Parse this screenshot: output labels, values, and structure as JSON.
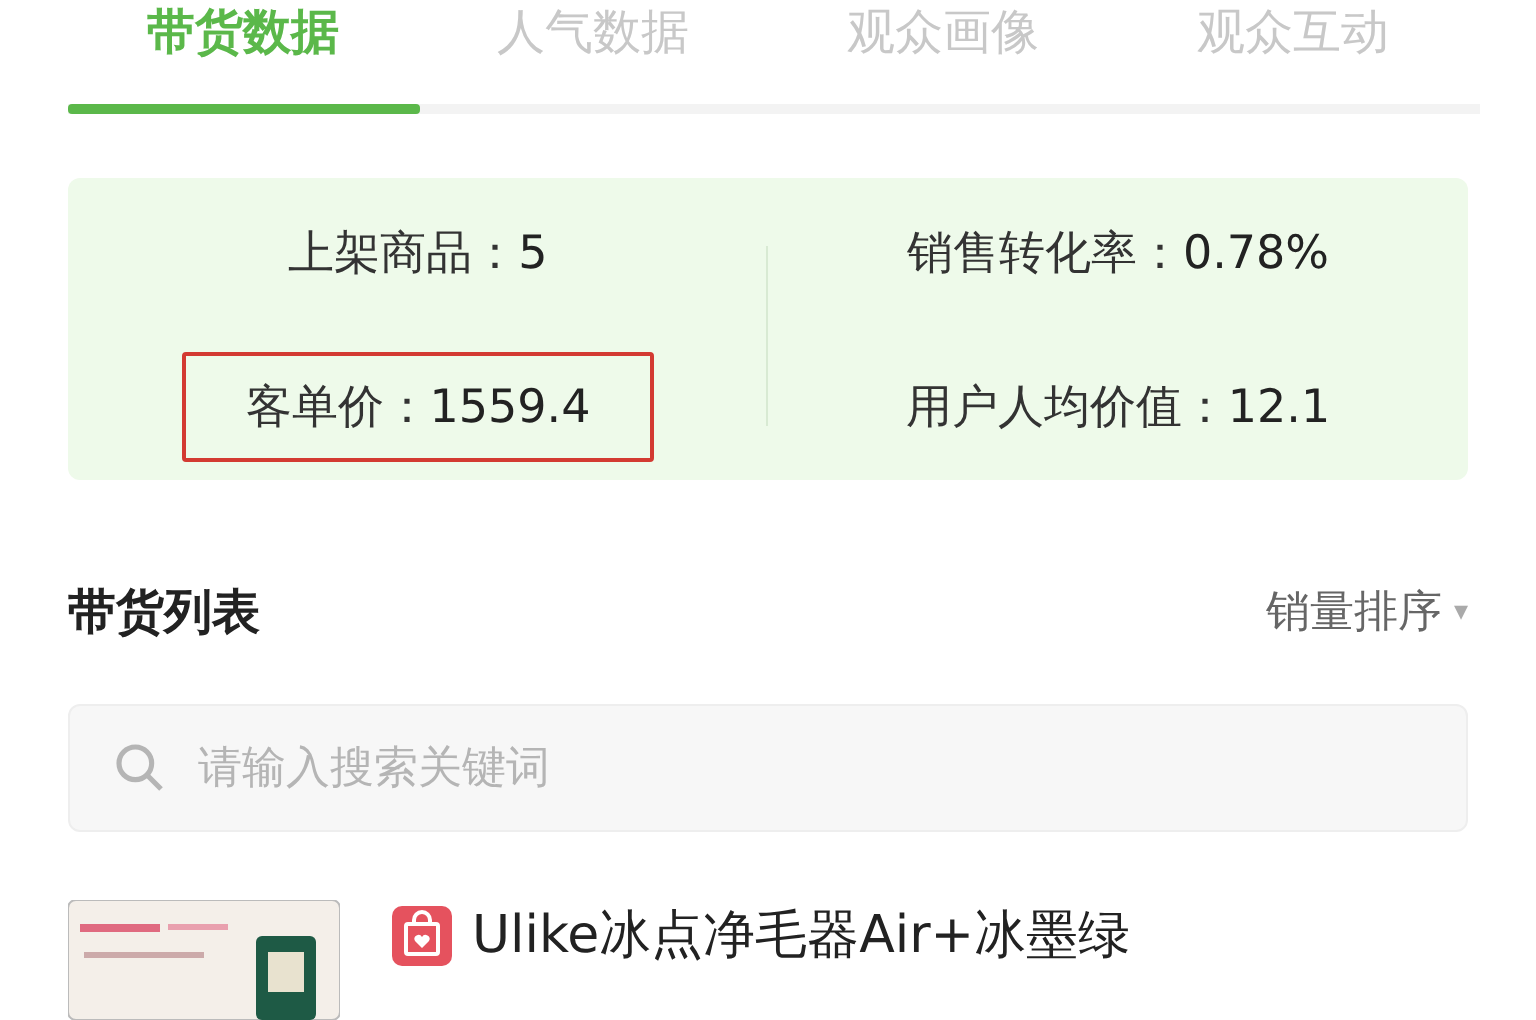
{
  "tabs": [
    {
      "label": "带货数据",
      "selected": true
    },
    {
      "label": "人气数据",
      "selected": false
    },
    {
      "label": "观众画像",
      "selected": false
    },
    {
      "label": "观众互动",
      "selected": false
    }
  ],
  "stats": [
    {
      "label": "上架商品：",
      "value": "5",
      "highlighted": false
    },
    {
      "label": "销售转化率：",
      "value": "0.78%",
      "highlighted": false
    },
    {
      "label": "客单价：",
      "value": "1559.4",
      "highlighted": true
    },
    {
      "label": "用户人均价值：",
      "value": "12.1",
      "highlighted": false
    }
  ],
  "list": {
    "title": "带货列表",
    "sort": "销量排序",
    "sort_caret": "▾"
  },
  "search": {
    "placeholder": "请输入搜索关键词"
  },
  "products": [
    {
      "title": "Ulike冰点净毛器Air+冰墨绿"
    }
  ]
}
